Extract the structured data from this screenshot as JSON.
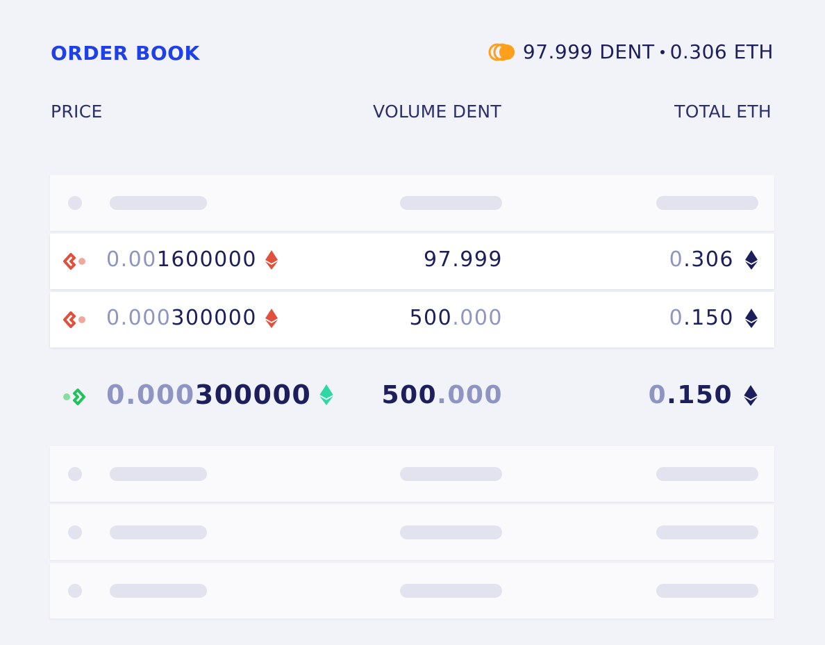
{
  "header": {
    "title": "ORDER BOOK",
    "balance_dent": "97.999 DENT",
    "balance_eth": "0.306 ETH",
    "coin_icon": "dent-coin-icon"
  },
  "columns": {
    "price": "PRICE",
    "volume": "VOLUME DENT",
    "total": "TOTAL ETH"
  },
  "colors": {
    "accent": "#1f3fe8",
    "sell": "#e0513d",
    "buy": "#22c35b",
    "eth_buy": "#2ed8a3",
    "coin": "#ff9f1a",
    "text": "#1c1f5c",
    "dim": "#8f95c3"
  },
  "sell_orders": [
    {
      "side_icon": "sell-arrow-icon",
      "price_dim": "0.00",
      "price_main": "1600000",
      "volume_main": "97.999",
      "volume_dim": "",
      "total_dim": "0",
      "total_main": ".306",
      "eth_icon": "eth-icon"
    },
    {
      "side_icon": "sell-arrow-icon",
      "price_dim": "0.000",
      "price_main": "300000",
      "volume_main": "500",
      "volume_dim": ".000",
      "total_dim": "0",
      "total_main": ".150",
      "eth_icon": "eth-icon"
    }
  ],
  "buy_order": {
    "side_icon": "buy-arrow-icon",
    "price_dim": "0.000",
    "price_main": "300000",
    "volume_main": "500",
    "volume_dim": ".000",
    "total_dim": "0",
    "total_main": ".150",
    "eth_icon": "eth-icon"
  }
}
